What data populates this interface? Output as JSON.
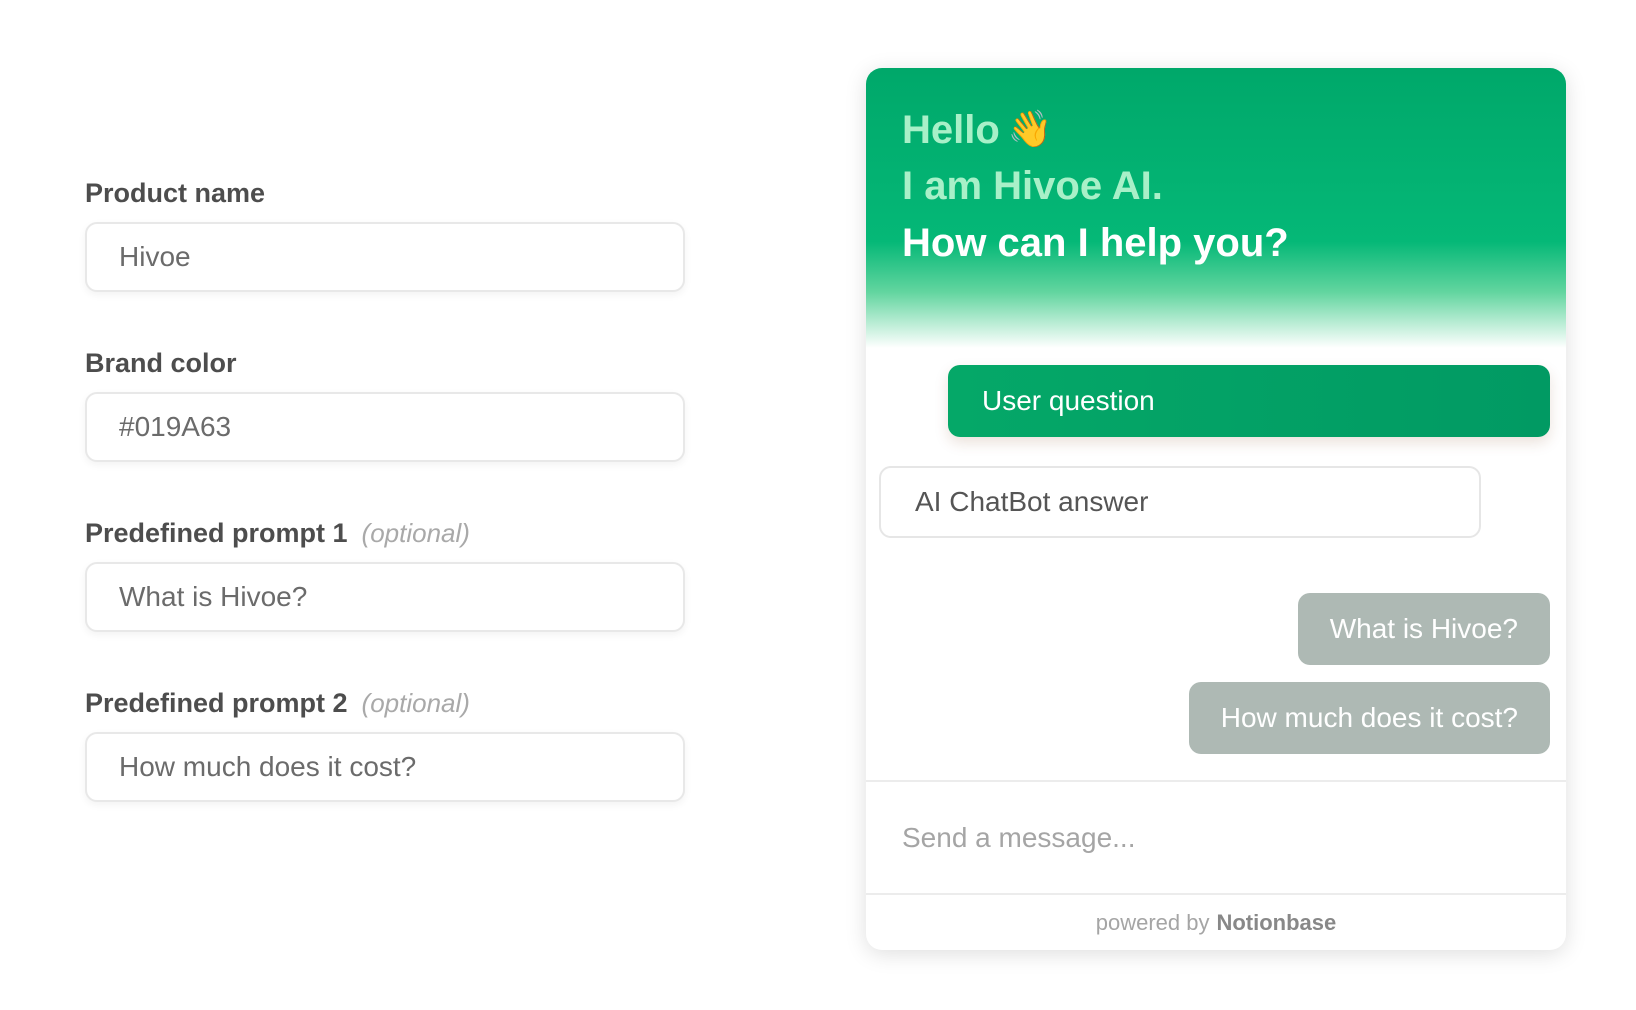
{
  "form": {
    "product_name": {
      "label": "Product name",
      "value": "Hivoe"
    },
    "brand_color": {
      "label": "Brand color",
      "value": "#019A63"
    },
    "prompt_1": {
      "label": "Predefined prompt 1",
      "optional": "(optional)",
      "value": "What is Hivoe?"
    },
    "prompt_2": {
      "label": "Predefined prompt 2",
      "optional": "(optional)",
      "value": "How much does it cost?"
    }
  },
  "chat": {
    "greeting": {
      "line1": "Hello",
      "line1_emoji": "👋",
      "line2": "I am Hivoe AI.",
      "line3": "How can I help you?"
    },
    "user_message": "User question",
    "bot_message": "AI ChatBot answer",
    "predefined_prompts": [
      "What is Hivoe?",
      "How much does it cost?"
    ],
    "input_placeholder": "Send a message...",
    "footer": {
      "prefix": "powered by",
      "brand": "Notionbase"
    }
  },
  "colors": {
    "brand": "#019A63",
    "header_top": "#00a86a",
    "prompt_chip": "#aeb9b4"
  }
}
